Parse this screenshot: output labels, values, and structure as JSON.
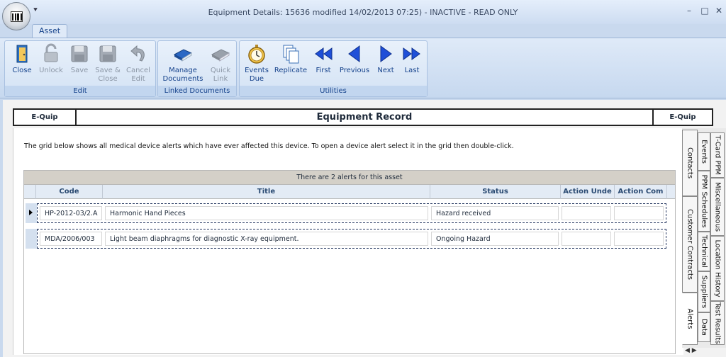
{
  "window": {
    "title": "Equipment Details: 15636 modified 14/02/2013 07:25) - INACTIVE - READ ONLY",
    "qat": "⯆",
    "minimize": "–",
    "maximize": "□",
    "close": "✕"
  },
  "ribbon": {
    "tab": "Asset",
    "groups": {
      "edit": "Edit",
      "linked_documents": "Linked Documents",
      "utilities": "Utilities"
    },
    "buttons": {
      "close": "Close",
      "unlock": "Unlock",
      "save": "Save",
      "save_close_1": "Save &",
      "save_close_2": "Close",
      "cancel_edit_1": "Cancel",
      "cancel_edit_2": "Edit",
      "manage_docs_1": "Manage",
      "manage_docs_2": "Documents",
      "quick_link_1": "Quick",
      "quick_link_2": "Link",
      "events_due_1": "Events",
      "events_due_2": "Due",
      "replicate": "Replicate",
      "first": "First",
      "previous": "Previous",
      "next": "Next",
      "last": "Last"
    }
  },
  "header": {
    "left": "E-Quip",
    "center": "Equipment Record",
    "right": "E-Quip"
  },
  "info_text": "The grid below shows all medical device alerts which have ever affected this device. To open a device alert select it in the grid then double-click.",
  "grid": {
    "caption": "There are 2 alerts for this asset",
    "columns": [
      "Code",
      "Title",
      "Status",
      "Action Unde",
      "Action Com"
    ],
    "rows": [
      {
        "code": "HP-2012-03/2.A",
        "title": "Harmonic Hand Pieces",
        "status": "Hazard received",
        "action_under": "",
        "action_complete": ""
      },
      {
        "code": "MDA/2006/003",
        "title": "Light beam diaphragms for diagnostic X-ray equipment.",
        "status": "Ongoing Hazard",
        "action_under": "",
        "action_complete": ""
      }
    ]
  },
  "side_tabs": {
    "contacts": "Contacts",
    "customer_contracts": "Customer Contracts",
    "alerts": "Alerts",
    "events": "Events",
    "ppm_schedules": "PPM Schedules",
    "technical": "Technical",
    "suppliers": "Suppliers",
    "data": "Data",
    "tcard_ppm": "T-Card PPM",
    "miscellaneous": "Miscellaneous",
    "location_history": "Location History",
    "test_results": "Test Results",
    "nav": "◀ ▶"
  },
  "colors": {
    "ribbon_text": "#15428b",
    "disabled_text": "#8c97a6",
    "nav_arrow": "#1f4fd8"
  }
}
